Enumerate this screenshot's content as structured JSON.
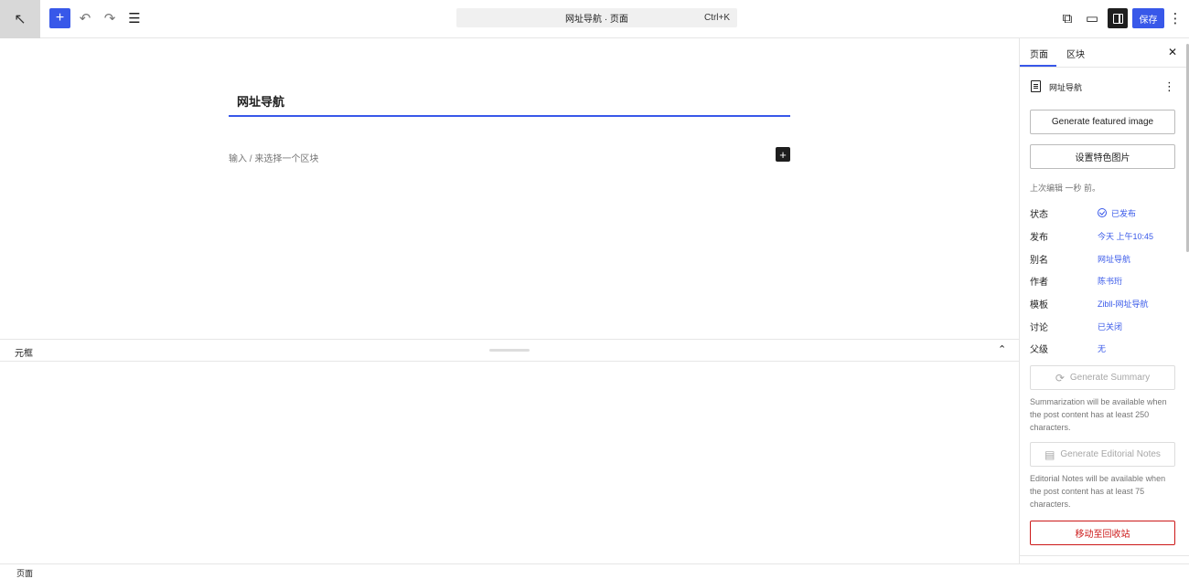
{
  "header": {
    "command_title": "网址导航 · 页面",
    "command_shortcut": "Ctrl+K",
    "save_label": "保存",
    "icons": {
      "back": "arrow-up-left-icon",
      "add": "plus-icon",
      "undo": "undo-icon",
      "redo": "redo-icon",
      "outline": "list-view-icon",
      "view_external": "external-link-icon",
      "preview": "desktop-preview-icon",
      "settings": "sidebar-panel-icon",
      "more": "more-vertical-icon"
    }
  },
  "editor": {
    "post_title": "网址导航",
    "block_placeholder": "输入 / 来选择一个区块"
  },
  "meta_boxes": {
    "label": "元框"
  },
  "footer": {
    "breadcrumb": "页面"
  },
  "sidebar": {
    "tabs": [
      {
        "label": "页面",
        "active": true
      },
      {
        "label": "区块",
        "active": false
      }
    ],
    "doc_title": "网址导航",
    "generate_featured_label": "Generate featured image",
    "set_featured_label": "设置特色图片",
    "last_edited": "上次编辑 一秒 前。",
    "rows": [
      {
        "key": "状态",
        "value": "已发布"
      },
      {
        "key": "发布",
        "value": "今天 上午10:45"
      },
      {
        "key": "别名",
        "value": "网址导航"
      },
      {
        "key": "作者",
        "value": "陈书珩"
      },
      {
        "key": "模板",
        "value": "Zibll-网址导航"
      },
      {
        "key": "讨论",
        "value": "已关闭"
      },
      {
        "key": "父级",
        "value": "无"
      }
    ],
    "generate_summary_label": "Generate Summary",
    "summary_note": "Summarization will be available when the post content has at least 250 characters.",
    "generate_notes_label": "Generate Editorial Notes",
    "notes_note": "Editorial Notes will be available when the post content has at least 75 characters.",
    "trash_label": "移动至回收站"
  },
  "colors": {
    "accent": "#3858e9",
    "danger": "#cc1818",
    "muted": "#757575"
  }
}
